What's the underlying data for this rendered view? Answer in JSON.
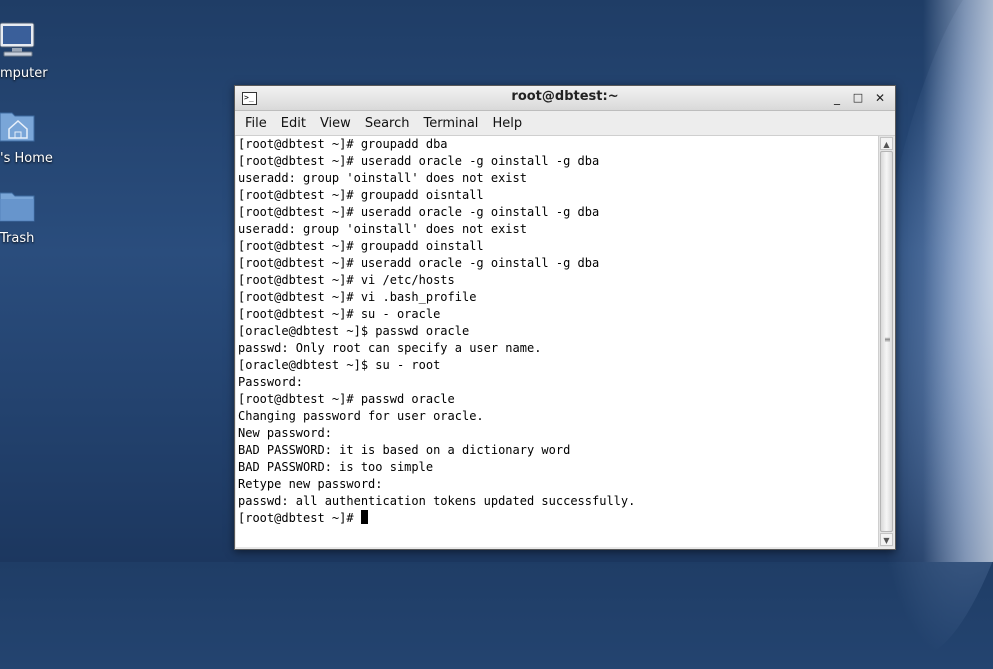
{
  "desktop": {
    "icons": [
      {
        "label": "mputer",
        "icon": "computer-icon"
      },
      {
        "label": "'s Home",
        "icon": "home-folder-icon"
      },
      {
        "label": "Trash",
        "icon": "trash-icon"
      }
    ]
  },
  "window": {
    "title": "root@dbtest:~",
    "controls": {
      "minimize": "_",
      "maximize": "□",
      "close": "✕"
    }
  },
  "menu": [
    "File",
    "Edit",
    "View",
    "Search",
    "Terminal",
    "Help"
  ],
  "terminal": {
    "lines": [
      "[root@dbtest ~]# groupadd dba",
      "[root@dbtest ~]# useradd oracle -g oinstall -g dba",
      "useradd: group 'oinstall' does not exist",
      "[root@dbtest ~]# groupadd oisntall",
      "[root@dbtest ~]# useradd oracle -g oinstall -g dba",
      "useradd: group 'oinstall' does not exist",
      "[root@dbtest ~]# groupadd oinstall",
      "[root@dbtest ~]# useradd oracle -g oinstall -g dba",
      "[root@dbtest ~]# vi /etc/hosts",
      "[root@dbtest ~]# vi .bash_profile",
      "[root@dbtest ~]# su - oracle",
      "[oracle@dbtest ~]$ passwd oracle",
      "passwd: Only root can specify a user name.",
      "[oracle@dbtest ~]$ su - root",
      "Password:",
      "[root@dbtest ~]# passwd oracle",
      "Changing password for user oracle.",
      "New password:",
      "BAD PASSWORD: it is based on a dictionary word",
      "BAD PASSWORD: is too simple",
      "Retype new password:",
      "passwd: all authentication tokens updated successfully."
    ],
    "prompt": "[root@dbtest ~]# "
  }
}
